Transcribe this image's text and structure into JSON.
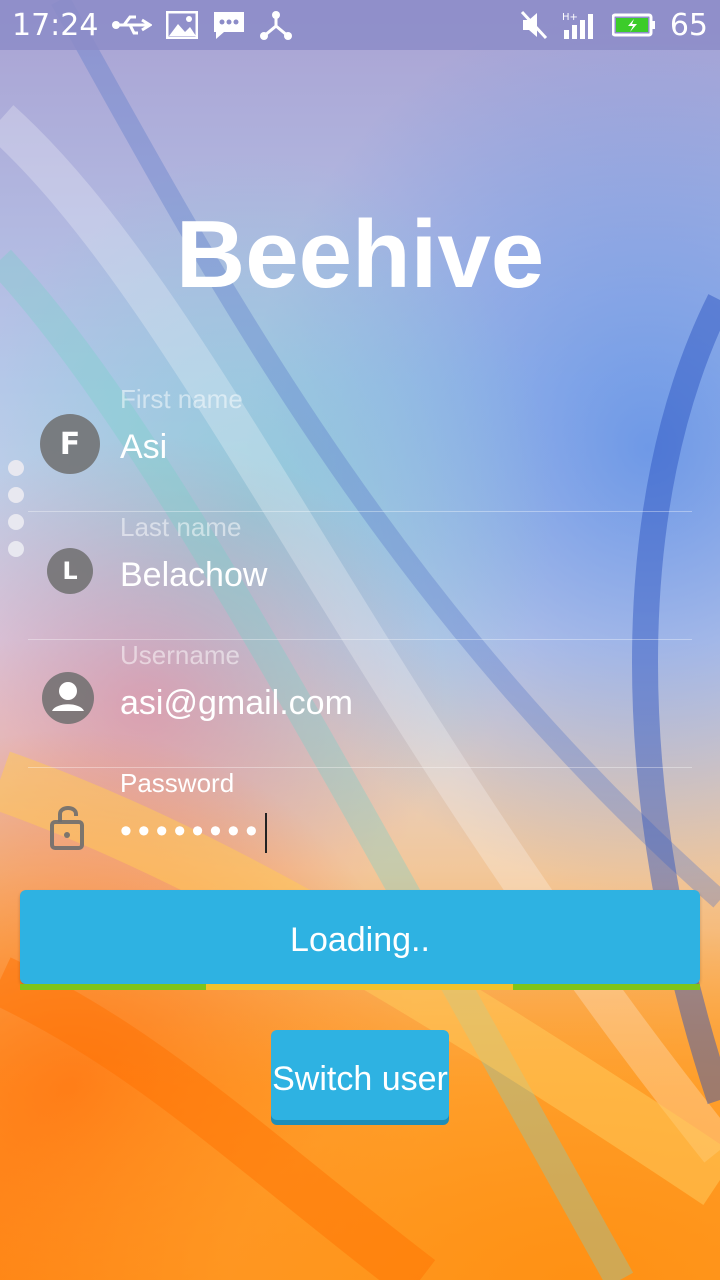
{
  "status_bar": {
    "time": "17:24",
    "battery": "65",
    "left_icons": [
      "usb-icon",
      "image-icon",
      "message-icon",
      "share-icon"
    ],
    "right_icons": [
      "mute-icon",
      "signal-icon",
      "battery-icon"
    ]
  },
  "app": {
    "title": "Beehive"
  },
  "form": {
    "first_name": {
      "label": "First name",
      "value": "Asi",
      "icon_letter": "F"
    },
    "last_name": {
      "label": "Last name",
      "value": "Belachow",
      "icon_letter": "L"
    },
    "username": {
      "label": "Username",
      "value": "asi@gmail.com"
    },
    "password": {
      "label": "Password",
      "value": "••••••••"
    }
  },
  "buttons": {
    "login_label": "Loading..",
    "switch_user_label": "Switch user"
  },
  "colors": {
    "button": "#2eb2e2",
    "progress_green": "#7fc41a",
    "progress_yellow": "#f3c22a",
    "accent_line": "#5fc3d7"
  }
}
